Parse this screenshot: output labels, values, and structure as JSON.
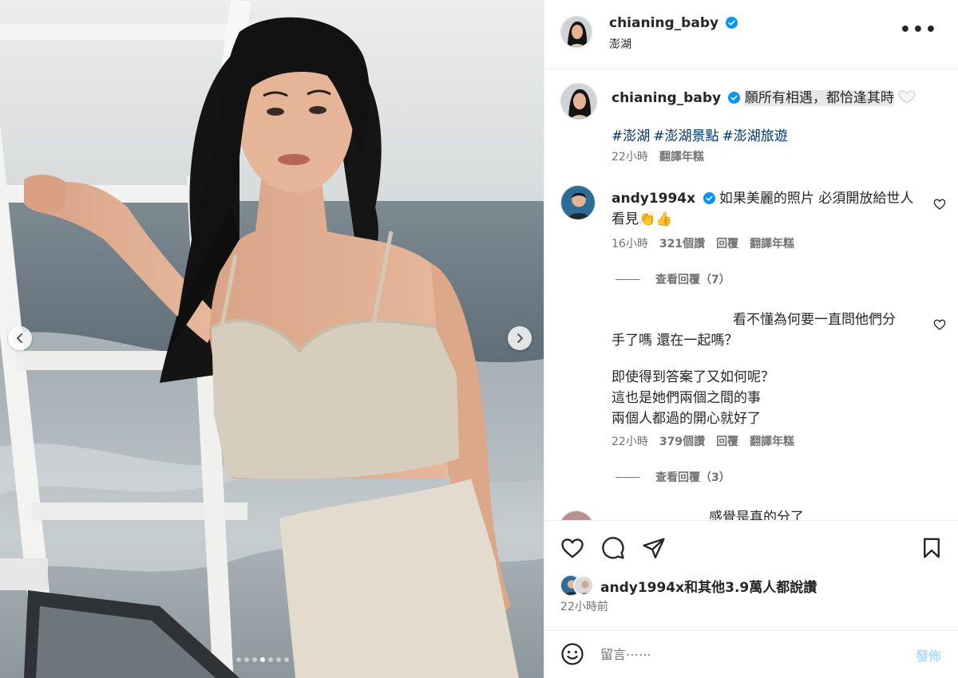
{
  "colors": {
    "accent": "#0095f6",
    "link": "#00376b",
    "text": "#262626",
    "muted": "#737373",
    "post_disabled": "#b3dbff"
  },
  "photo": {
    "dots_count": 7,
    "active_dot": 4
  },
  "header": {
    "username": "chianing_baby",
    "location": "澎湖"
  },
  "caption": {
    "username": "chianing_baby",
    "text": "願所有相遇，都恰逢其時",
    "hashtags": [
      "#澎湖",
      "#澎湖景點",
      "#澎湖旅遊"
    ],
    "time": "22小時",
    "translate": "翻譯年糕"
  },
  "comments": [
    {
      "username": "andy1994x",
      "line1": "如果美麗的照片 必須開放給世人",
      "line2": "看見👏👍",
      "time": "16小時",
      "likes": "321個讚",
      "reply": "回覆",
      "translate": "翻譯年糕",
      "view_replies": "查看回覆（7）"
    },
    {
      "line1": "看不懂為何要一直問他們分",
      "line2": "手了嗎 還在一起嗎？",
      "line3": "即使得到答案了又如何呢？",
      "line4": "這也是她們兩個之間的事",
      "line5": "兩個人都過的開心就好了",
      "time": "22小時",
      "likes": "379個讚",
      "reply": "回覆",
      "translate": "翻譯年糕",
      "view_replies": "查看回覆（3）"
    },
    {
      "line1": "感覺是真的分了"
    }
  ],
  "actions": {
    "likes_user": "andy1994x",
    "likes_text": "和其他3.9萬人都說讚",
    "time": "22小時前"
  },
  "comment_bar": {
    "placeholder": "留言⋯⋯",
    "post_label": "發佈"
  }
}
